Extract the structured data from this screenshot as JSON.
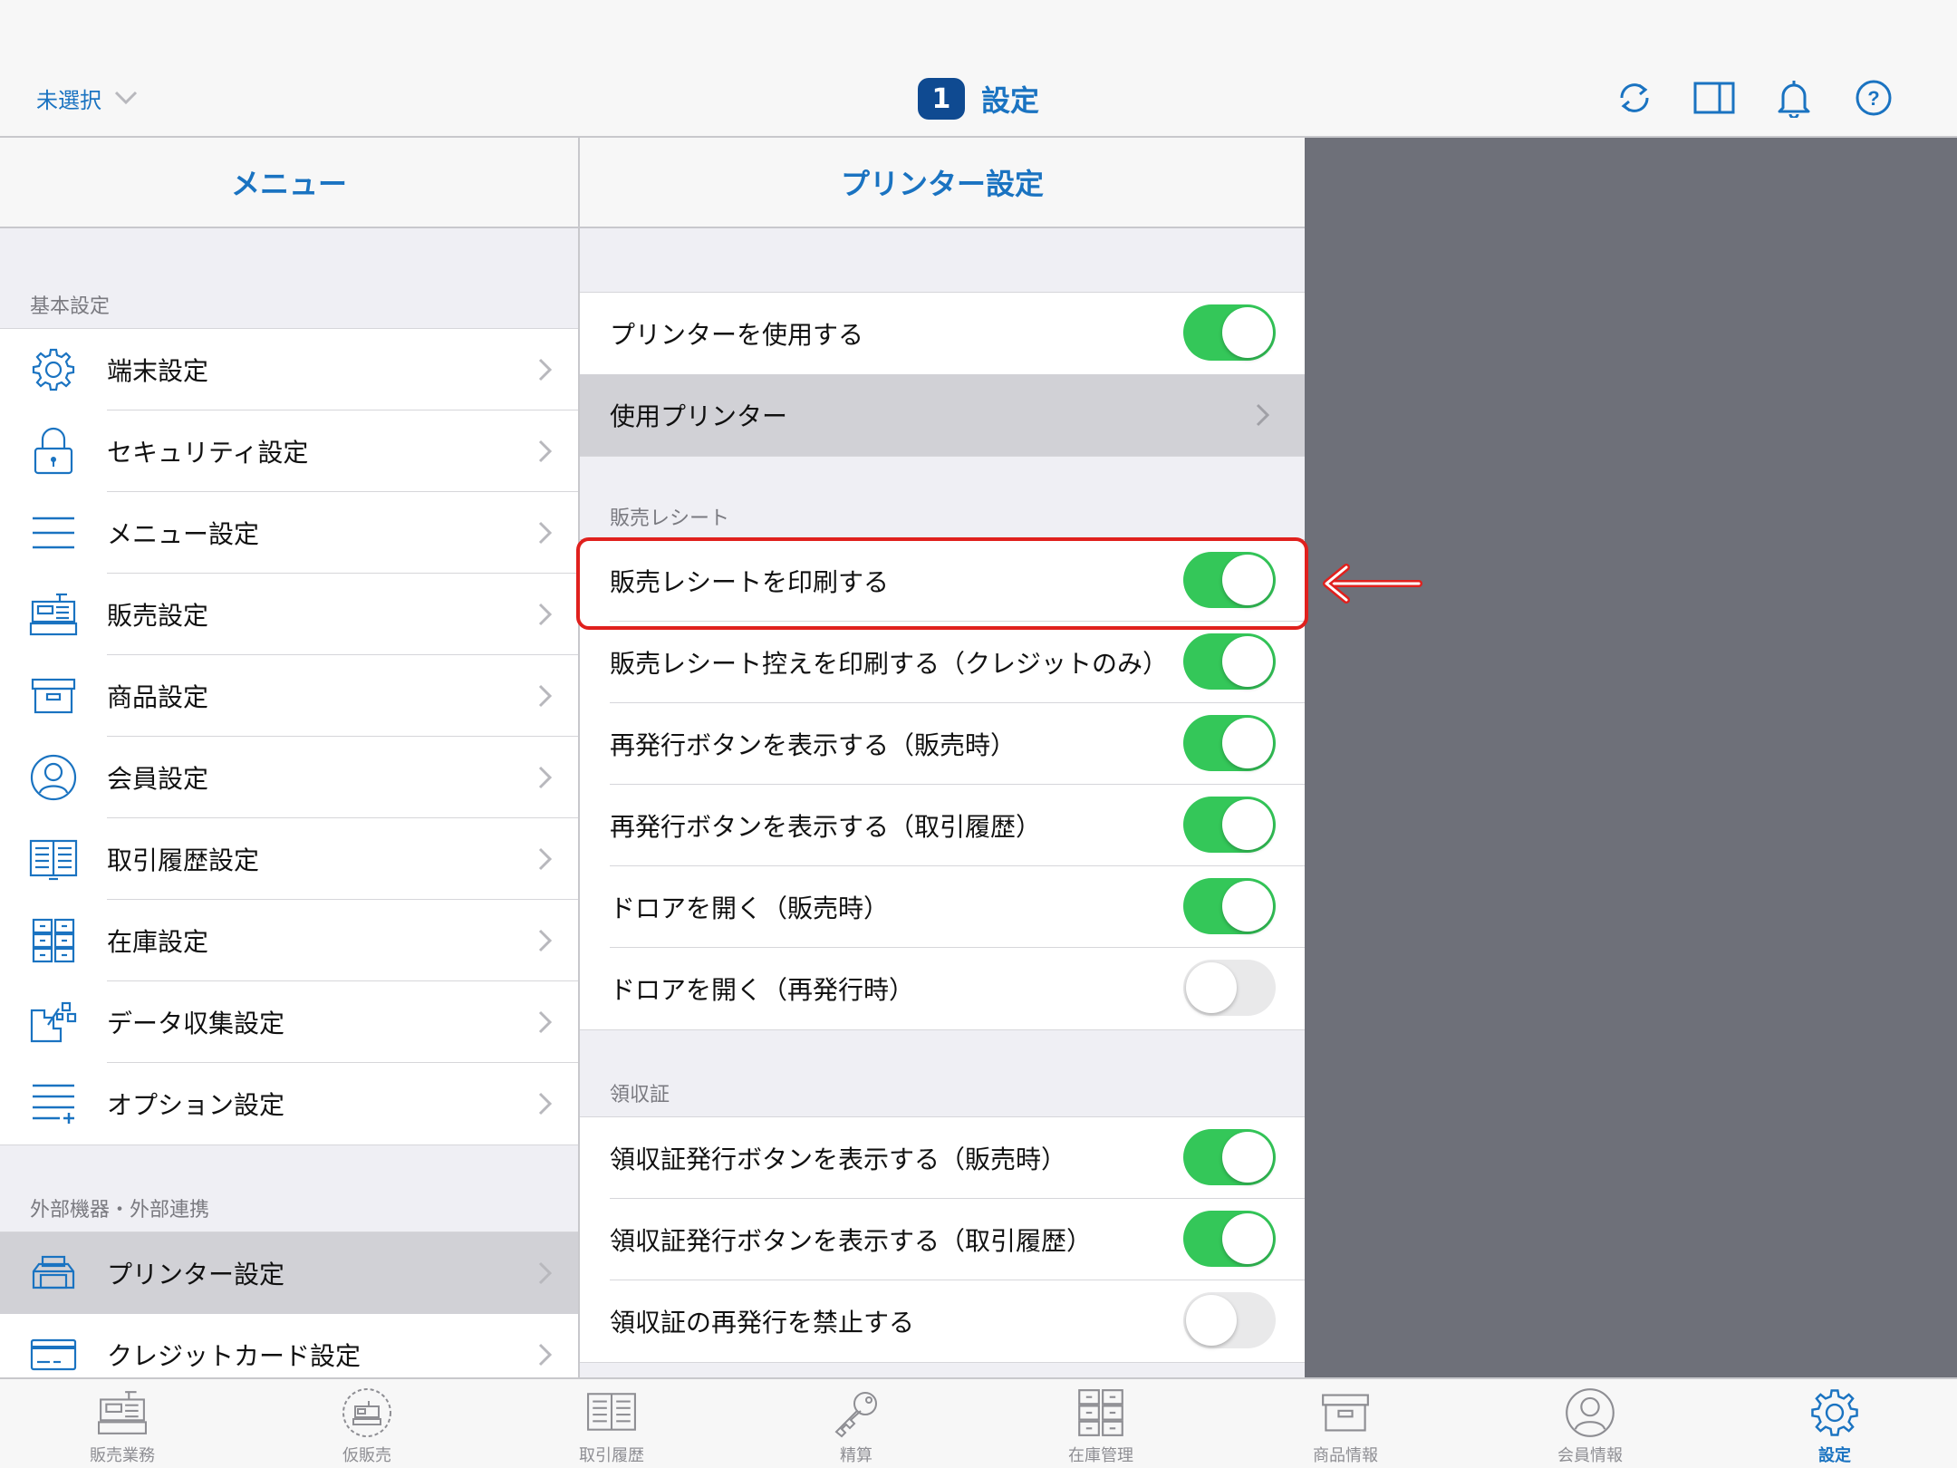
{
  "header": {
    "store_selector": "未選択",
    "badge_number": "1",
    "title": "設定",
    "icons": [
      "sync-icon",
      "split-view-icon",
      "bell-icon",
      "help-icon"
    ]
  },
  "menu": {
    "title": "メニュー",
    "sections": [
      {
        "label": "基本設定",
        "items": [
          {
            "label": "端末設定",
            "icon": "gear-icon"
          },
          {
            "label": "セキュリティ設定",
            "icon": "lock-icon"
          },
          {
            "label": "メニュー設定",
            "icon": "list-icon"
          },
          {
            "label": "販売設定",
            "icon": "register-icon"
          },
          {
            "label": "商品設定",
            "icon": "box-icon"
          },
          {
            "label": "会員設定",
            "icon": "person-icon"
          },
          {
            "label": "取引履歴設定",
            "icon": "book-icon"
          },
          {
            "label": "在庫設定",
            "icon": "cabinet-icon"
          },
          {
            "label": "データ収集設定",
            "icon": "data-collect-icon"
          },
          {
            "label": "オプション設定",
            "icon": "options-list-icon"
          }
        ]
      },
      {
        "label": "外部機器・外部連携",
        "items": [
          {
            "label": "プリンター設定",
            "icon": "printer-icon",
            "selected": true
          },
          {
            "label": "クレジットカード設定",
            "icon": "credit-card-icon"
          }
        ]
      }
    ]
  },
  "settings": {
    "title": "プリンター設定",
    "use_printer": {
      "label": "プリンターを使用する",
      "on": true
    },
    "printer_select": {
      "label": "使用プリンター"
    },
    "sales_receipt": {
      "label": "販売レシート",
      "rows": [
        {
          "label": "販売レシートを印刷する",
          "on": true,
          "highlighted": true
        },
        {
          "label": "販売レシート控えを印刷する（クレジットのみ）",
          "on": true
        },
        {
          "label": "再発行ボタンを表示する（販売時）",
          "on": true
        },
        {
          "label": "再発行ボタンを表示する（取引履歴）",
          "on": true
        },
        {
          "label": "ドロアを開く（販売時）",
          "on": true
        },
        {
          "label": "ドロアを開く（再発行時）",
          "on": false
        }
      ]
    },
    "receipt": {
      "label": "領収証",
      "rows": [
        {
          "label": "領収証発行ボタンを表示する（販売時）",
          "on": true
        },
        {
          "label": "領収証発行ボタンを表示する（取引履歴）",
          "on": true
        },
        {
          "label": "領収証の再発行を禁止する",
          "on": false
        }
      ]
    }
  },
  "tabbar": {
    "tabs": [
      {
        "label": "販売業務",
        "icon": "register-icon"
      },
      {
        "label": "仮販売",
        "icon": "temp-sale-icon"
      },
      {
        "label": "取引履歴",
        "icon": "book-icon"
      },
      {
        "label": "精算",
        "icon": "key-icon"
      },
      {
        "label": "在庫管理",
        "icon": "cabinet-icon"
      },
      {
        "label": "商品情報",
        "icon": "box-icon"
      },
      {
        "label": "会員情報",
        "icon": "person-icon"
      },
      {
        "label": "設定",
        "icon": "gear-icon",
        "active": true
      }
    ]
  },
  "colors": {
    "accent": "#1a73c1",
    "badge": "#0f4a91",
    "toggle_on": "#34c759",
    "highlight": "#e0201d",
    "tab_inactive": "#8e8e93"
  }
}
